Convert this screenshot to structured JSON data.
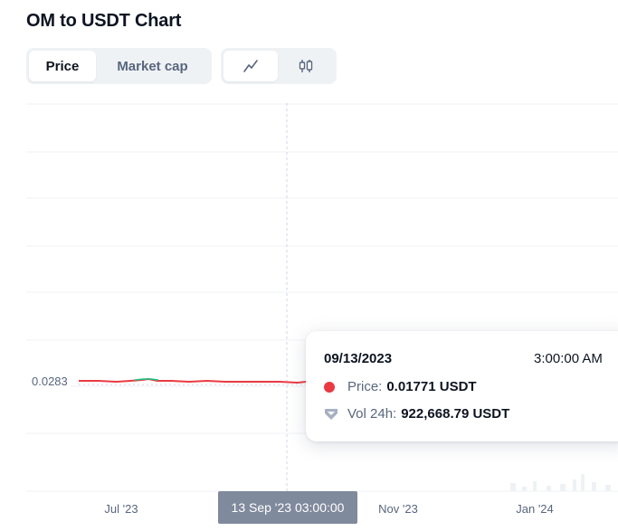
{
  "title": "OM to USDT Chart",
  "metric_tabs": [
    "Price",
    "Market cap"
  ],
  "active_metric": "Price",
  "view_tabs": [
    {
      "icon": "line-chart-icon"
    },
    {
      "icon": "candlestick-icon"
    }
  ],
  "active_view": "line-chart-icon",
  "chart": {
    "current_price_label": "0.0283",
    "x_ticks": [
      "Jul '23",
      "Nov '23",
      "Jan '24"
    ],
    "crosshair_label": "13 Sep '23 03:00:00",
    "line_color": "#ea3943",
    "up_color": "#16c784"
  },
  "tooltip": {
    "date": "09/13/2023",
    "time": "3:00:00 AM",
    "price_label": "Price:",
    "price_value": "0.01771 USDT",
    "vol_label": "Vol 24h:",
    "vol_value": "922,668.79 USDT"
  }
}
